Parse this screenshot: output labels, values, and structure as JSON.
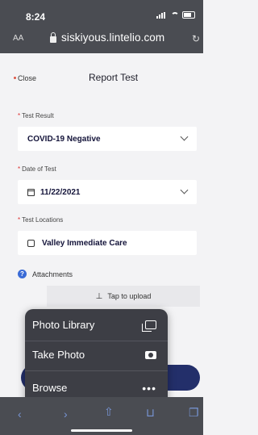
{
  "status_bar": {
    "time": "8:24"
  },
  "browser": {
    "text_size": "AA",
    "url": "siskiyous.lintelio.com"
  },
  "header": {
    "close_label": "Close",
    "title": "Report Test"
  },
  "form": {
    "test_result": {
      "label": "Test Result",
      "value": "COVID-19 Negative"
    },
    "date_of_test": {
      "label": "Date of Test",
      "value": "11/22/2021"
    },
    "test_locations": {
      "label": "Test Locations",
      "value": "Valley Immediate Care"
    },
    "attachments": {
      "label": "Attachments",
      "upload_label": "Tap to upload"
    }
  },
  "popover": {
    "items": [
      {
        "label": "Photo Library",
        "icon": "photo-library-icon"
      },
      {
        "label": "Take Photo",
        "icon": "camera-icon"
      },
      {
        "label": "Browse",
        "icon": "more-icon"
      }
    ]
  },
  "toolbar": {
    "icons": [
      "back-icon",
      "forward-icon",
      "share-icon",
      "bookmarks-icon",
      "tabs-icon"
    ]
  }
}
